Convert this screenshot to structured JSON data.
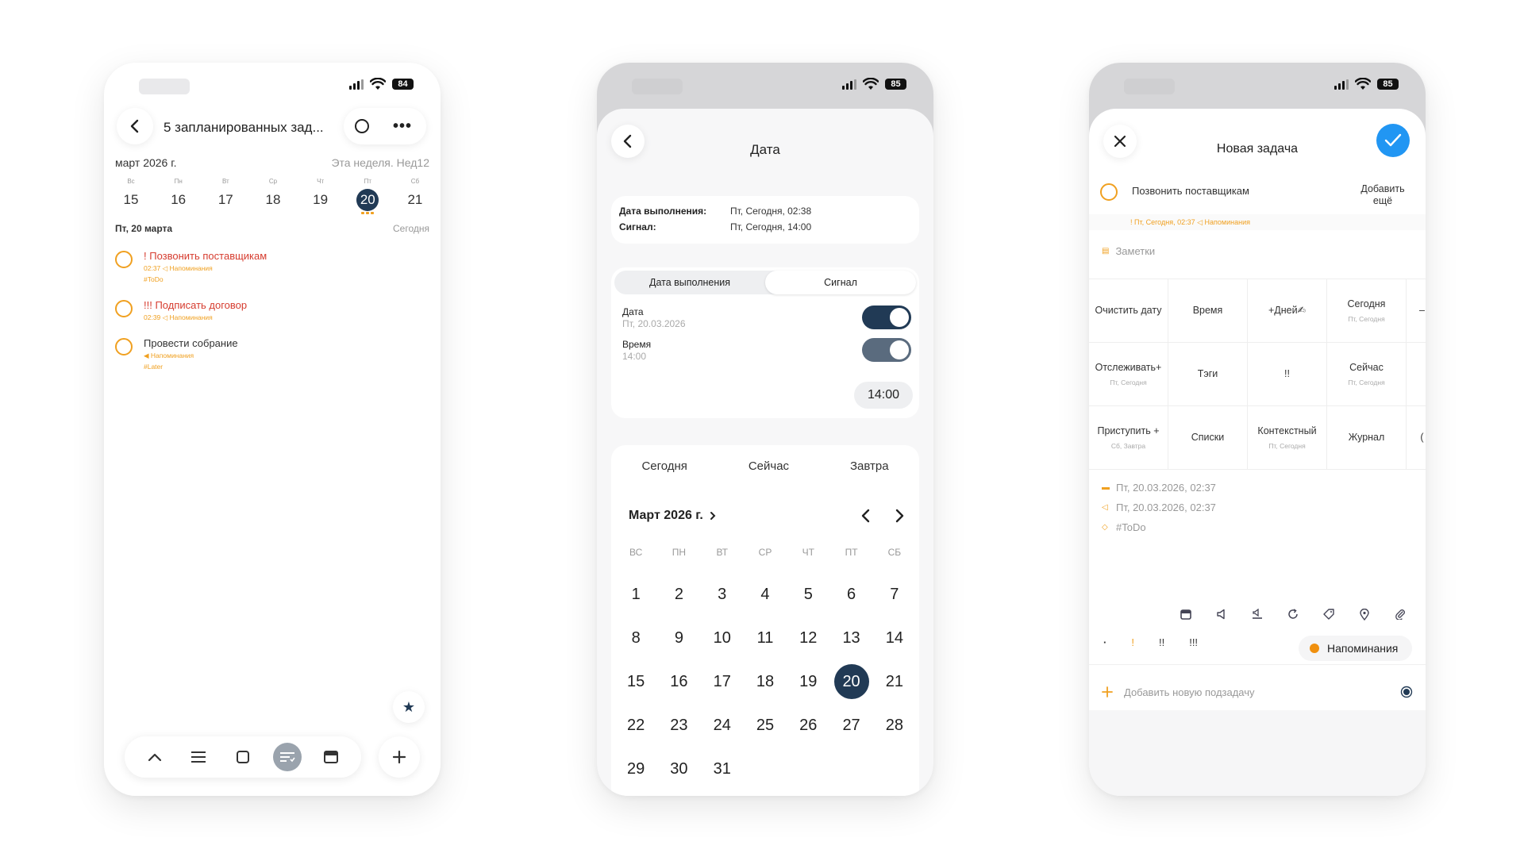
{
  "screen1": {
    "battery": "84",
    "title": "5 запланированных зад...",
    "month": "март 2026 г.",
    "week_label": "Эта неделя. Нед12",
    "week": [
      {
        "dn": "Вс",
        "dd": "15"
      },
      {
        "dn": "Пн",
        "dd": "16"
      },
      {
        "dn": "Вт",
        "dd": "17"
      },
      {
        "dn": "Ср",
        "dd": "18"
      },
      {
        "dn": "Чт",
        "dd": "19"
      },
      {
        "dn": "Пт",
        "dd": "20"
      },
      {
        "dn": "Сб",
        "dd": "21"
      }
    ],
    "day_header": "Пт, 20 марта",
    "day_tag": "Сегодня",
    "tasks": [
      {
        "title": "! Позвонить поставщикам",
        "meta": "02:37 ◁ Напоминания",
        "tag": "#ToDo"
      },
      {
        "title": "!!! Подписать договор",
        "meta": "02:39 ◁ Напоминания",
        "tag": ""
      },
      {
        "title": "Провести собрание",
        "meta": "◀ Напоминания",
        "tag": "#Later"
      }
    ]
  },
  "screen2": {
    "battery": "85",
    "title": "Дата",
    "due_key": "Дата выполнения:",
    "due_val": "Пт, Сегодня, 02:38",
    "signal_key": "Сигнал:",
    "signal_val": "Пт, Сегодня, 14:00",
    "seg_due": "Дата выполнения",
    "seg_signal": "Сигнал",
    "date_label": "Дата",
    "date_value": "Пт, 20.03.2026",
    "time_label": "Время",
    "time_value": "14:00",
    "time_chip": "14:00",
    "quick": [
      "Сегодня",
      "Сейчас",
      "Завтра"
    ],
    "month_title": "Март 2026 г.",
    "weekdays": [
      "ВС",
      "ПН",
      "ВТ",
      "СР",
      "ЧТ",
      "ПТ",
      "СБ"
    ],
    "days": [
      "1",
      "2",
      "3",
      "4",
      "5",
      "6",
      "7",
      "8",
      "9",
      "10",
      "11",
      "12",
      "13",
      "14",
      "15",
      "16",
      "17",
      "18",
      "19",
      "20",
      "21",
      "22",
      "23",
      "24",
      "25",
      "26",
      "27",
      "28",
      "29",
      "30",
      "31"
    ],
    "selected_day": "20"
  },
  "screen3": {
    "battery": "85",
    "title": "Новая задача",
    "task_title": "Позвонить поставщикам",
    "add_more": "Добавить ещё",
    "task_meta": "! Пт, Сегодня, 02:37 ◁ Напоминания",
    "notes": "Заметки",
    "quick_cells": [
      {
        "label": "Очистить дату",
        "sub": ""
      },
      {
        "label": "Время",
        "sub": ""
      },
      {
        "label": "+Дней✍",
        "sub": ""
      },
      {
        "label": "Сегодня",
        "sub": "Пт, Сегодня"
      },
      {
        "label": "–",
        "sub": ""
      },
      {
        "label": "Отслеживать+",
        "sub": "Пт, Сегодня"
      },
      {
        "label": "Тэги",
        "sub": ""
      },
      {
        "label": "!!",
        "sub": ""
      },
      {
        "label": "Сейчас",
        "sub": "Пт, Сегодня"
      },
      {
        "label": "",
        "sub": ""
      },
      {
        "label": "Приступить +",
        "sub": "Сб, Завтра"
      },
      {
        "label": "Списки",
        "sub": ""
      },
      {
        "label": "Контекстный",
        "sub": "Пт, Сегодня"
      },
      {
        "label": "Журнал",
        "sub": ""
      },
      {
        "label": "(",
        "sub": ""
      }
    ],
    "meta_rows": [
      {
        "icon": "▬",
        "text": "Пт, 20.03.2026, 02:37"
      },
      {
        "icon": "◁",
        "text": "Пт, 20.03.2026, 02:37"
      },
      {
        "icon": "◇",
        "text": "#ToDo"
      }
    ],
    "priorities": [
      "·",
      "!",
      "!!",
      "!!!"
    ],
    "reminder": "Напоминания",
    "add_subtask": "Добавить новую подзадачу"
  }
}
